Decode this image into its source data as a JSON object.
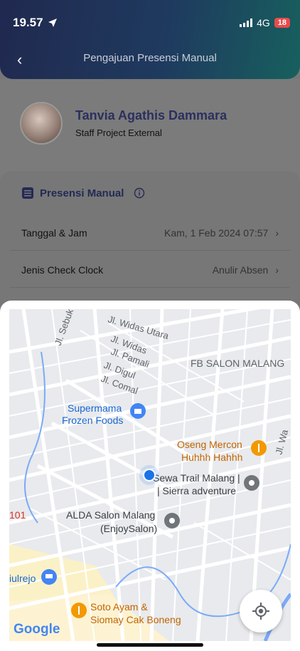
{
  "status_bar": {
    "time": "19.57",
    "network": "4G",
    "battery": "18"
  },
  "header": {
    "title": "Pengajuan Presensi Manual"
  },
  "profile": {
    "name": "Tanvia Agathis Dammara",
    "role": "Staff Project External"
  },
  "section": {
    "title": "Presensi Manual"
  },
  "rows": [
    {
      "label": "Tanggal & Jam",
      "value": "Kam, 1 Feb 2024 07:57"
    },
    {
      "label": "Jenis Check Clock",
      "value": "Anulir Absen"
    }
  ],
  "map": {
    "labels": {
      "street_1": "Jl. Widas Utara",
      "street_2": "Jl. Widas",
      "street_3": "Jl. Pamali",
      "street_4": "Jl. Digul",
      "street_5": "Jl. Comal",
      "street_6": "Jl. Sebuk",
      "place_1": "FB SALON MALANG",
      "place_2_line1": "Supermama",
      "place_2_line2": "Frozen Foods",
      "place_3_line1": "Oseng Mercon",
      "place_3_line2": "Huhhh Hahhh",
      "place_4_line1": "Sewa Trail Malang |",
      "place_4_line2": "| Sierra adventure",
      "place_5_line1": "ALDA Salon Malang",
      "place_5_line2": "(EnjoySalon)",
      "place_6_line1": "Soto Ayam &",
      "place_6_line2": "Siomay Cak Boneng",
      "edge_1": "101",
      "edge_2": "iulrejo",
      "edge_3": "Jl. Wa",
      "logo": "Google"
    }
  },
  "colors": {
    "accent": "#242a55",
    "map_blue": "#1a73e8",
    "poi_orange": "#f29900",
    "poi_blue": "#4285f4",
    "poi_gray": "#70757a"
  }
}
